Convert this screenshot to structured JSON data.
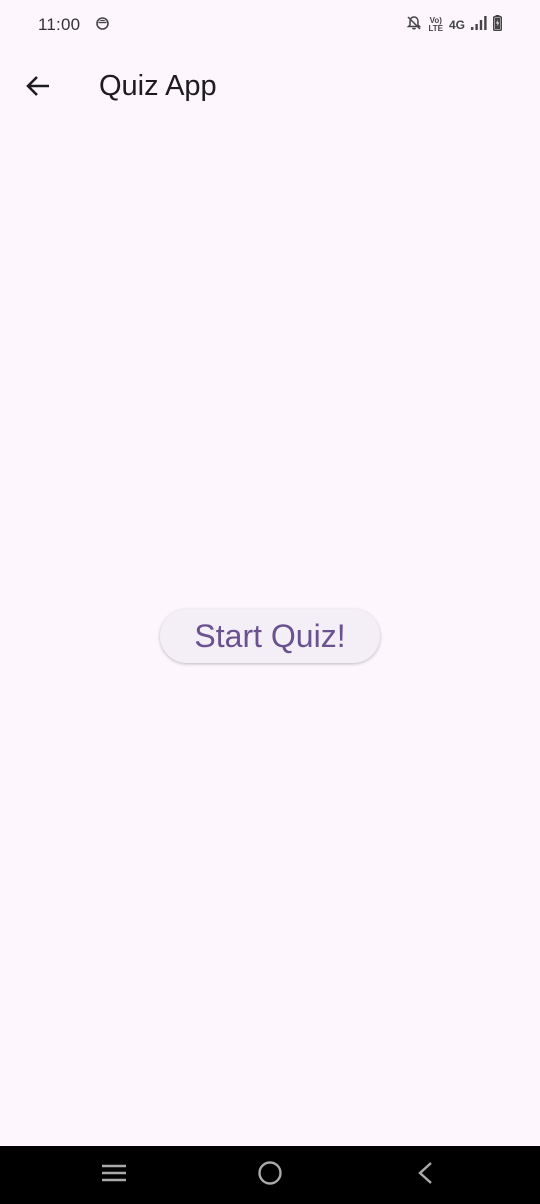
{
  "status_bar": {
    "time": "11:00",
    "app_icon": "app-notification-icon",
    "right_icons": [
      "notifications-off-icon",
      "volte-icon",
      "4g-icon",
      "signal-icon",
      "battery-charging-icon"
    ],
    "volte_top": "Vo)",
    "volte_bottom": "LTE",
    "network": "4G"
  },
  "app_bar": {
    "title": "Quiz App",
    "back_icon": "arrow-back-icon"
  },
  "main": {
    "start_button_label": "Start Quiz!"
  },
  "nav_bar": {
    "items": [
      "recents-menu-icon",
      "home-circle-icon",
      "back-chevron-icon"
    ]
  },
  "colors": {
    "background": "#fdf7fd",
    "primary": "#6a5291",
    "button_surface": "#f4eef6",
    "nav_bar": "#000000"
  }
}
